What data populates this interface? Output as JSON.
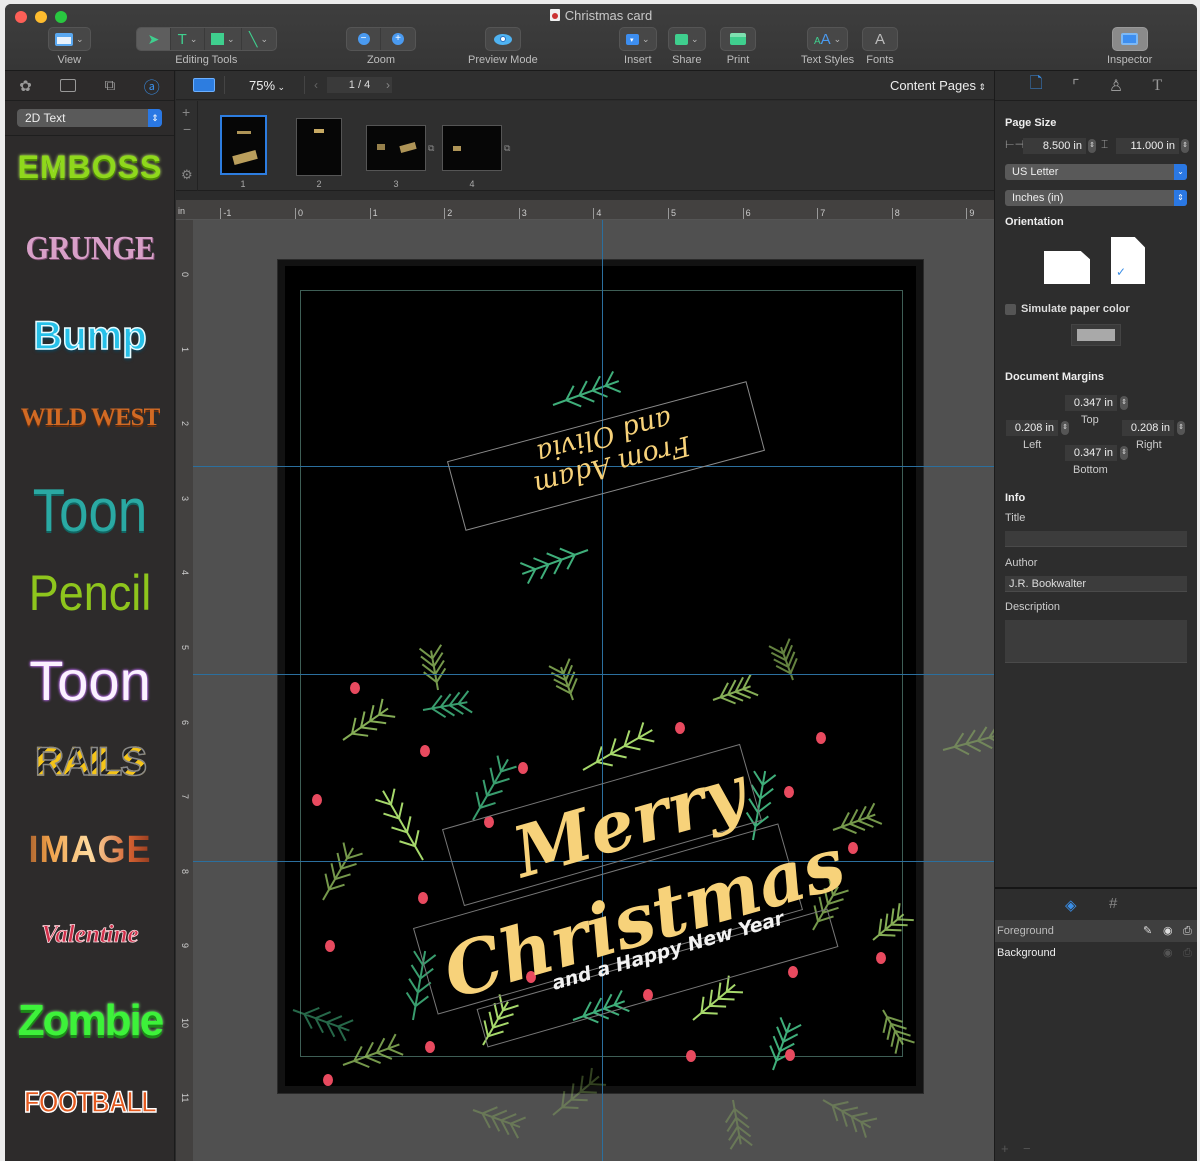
{
  "window": {
    "title": "Christmas card"
  },
  "toolbar": {
    "groups": [
      {
        "label": "View"
      },
      {
        "label": "Editing Tools"
      },
      {
        "label": "Zoom"
      },
      {
        "label": "Preview Mode"
      },
      {
        "label": "Insert"
      },
      {
        "label": "Share"
      },
      {
        "label": "Print"
      },
      {
        "label": "Text Styles"
      },
      {
        "label": "Fonts"
      },
      {
        "label": "Inspector"
      }
    ],
    "fonts_glyph": "A"
  },
  "left_sidebar": {
    "tabs": [
      "shapes-library",
      "image-library",
      "clipart-library",
      "text-styles-library"
    ],
    "active_tab": "text-styles-library",
    "style_category": "2D Text",
    "styles": [
      "EMBOSS",
      "GRUNGE",
      "Bump",
      "WILD WEST",
      "Toon",
      "Pencil",
      "Toon",
      "RAILS",
      "IMAGE",
      "Valentine",
      "Zombie",
      "FOOTBALL"
    ]
  },
  "canvas_bar": {
    "zoom": "75%",
    "page_indicator": "1 / 4",
    "view_mode": "Content Pages"
  },
  "thumbnails": [
    {
      "num": "1",
      "selected": true
    },
    {
      "num": "2",
      "selected": false
    },
    {
      "num": "3",
      "selected": false
    },
    {
      "num": "4",
      "selected": false
    }
  ],
  "ruler": {
    "unit": "in",
    "h_ticks": [
      "-1",
      "0",
      "1",
      "2",
      "3",
      "4",
      "5",
      "6",
      "7",
      "8",
      "9"
    ],
    "v_ticks": [
      "0",
      "1",
      "2",
      "3",
      "4",
      "5",
      "6",
      "7",
      "8",
      "9",
      "10",
      "11"
    ]
  },
  "card": {
    "top_text_line1": "From Adam",
    "top_text_line2": "and Olivia",
    "headline_1": "Merry",
    "headline_2": "Christmas",
    "subline": "and a Happy New Year",
    "colors": {
      "text": "#f7d27a",
      "greenery": "#3fae7a",
      "greenery_light": "#a6d86b",
      "berry": "#e84a5f",
      "background": "#000000"
    }
  },
  "inspector": {
    "page_size_title": "Page Size",
    "width": "8.500 in",
    "height": "11.000 in",
    "paper": "US Letter",
    "units": "Inches (in)",
    "orientation_title": "Orientation",
    "orientation": "portrait",
    "simulate_paper_label": "Simulate paper color",
    "simulate_paper_checked": false,
    "margins_title": "Document Margins",
    "margin_top": "0.347 in",
    "margin_top_label": "Top",
    "margin_left": "0.208 in",
    "margin_left_label": "Left",
    "margin_right": "0.208 in",
    "margin_right_label": "Right",
    "margin_bottom": "0.347 in",
    "margin_bottom_label": "Bottom",
    "info_title": "Info",
    "title_label": "Title",
    "title_value": "",
    "author_label": "Author",
    "author_value": "J.R. Bookwalter",
    "description_label": "Description",
    "description_value": ""
  },
  "layers": [
    {
      "name": "Foreground",
      "selected": true
    },
    {
      "name": "Background",
      "selected": false
    }
  ],
  "accent": "#2d7de0"
}
